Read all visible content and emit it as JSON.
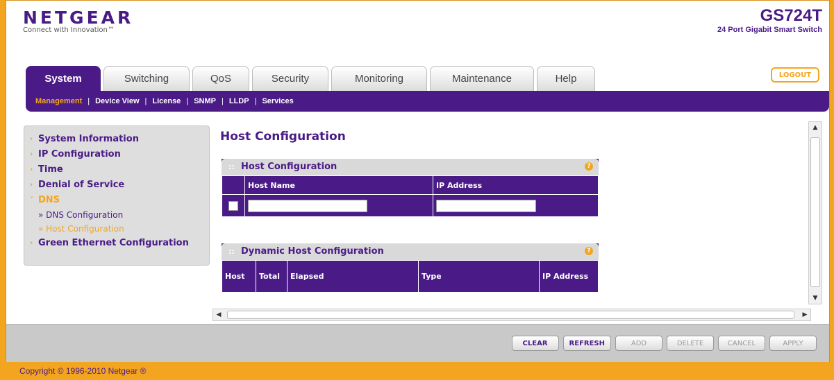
{
  "header": {
    "brand": "NETGEAR",
    "tagline": "Connect with Innovation™",
    "model": "GS724T",
    "model_desc": "24 Port Gigabit Smart Switch",
    "logout": "LOGOUT"
  },
  "tabs": [
    "System",
    "Switching",
    "QoS",
    "Security",
    "Monitoring",
    "Maintenance",
    "Help"
  ],
  "subnav": [
    "Management",
    "Device View",
    "License",
    "SNMP",
    "LLDP",
    "Services"
  ],
  "sidebar": {
    "items": [
      "System Information",
      "IP Configuration",
      "Time",
      "Denial of Service",
      "DNS"
    ],
    "dns_children": [
      "» DNS Configuration",
      "» Host Configuration"
    ],
    "last": "Green Ethernet Configuration"
  },
  "page_title": "Host Configuration",
  "host_section": {
    "title": "Host Configuration",
    "col_name": "Host Name",
    "col_ip": "IP Address"
  },
  "dyn_section": {
    "title": "Dynamic Host Configuration",
    "cols": [
      "Host",
      "Total",
      "Elapsed",
      "Type",
      "IP Address"
    ]
  },
  "buttons": {
    "clear": "CLEAR",
    "refresh": "REFRESH",
    "add": "ADD",
    "delete": "DELETE",
    "cancel": "CANCEL",
    "apply": "APPLY"
  },
  "footer": "Copyright © 1996-2010 Netgear ®",
  "colors": {
    "purple": "#4a1b86",
    "orange": "#f3a51f"
  }
}
